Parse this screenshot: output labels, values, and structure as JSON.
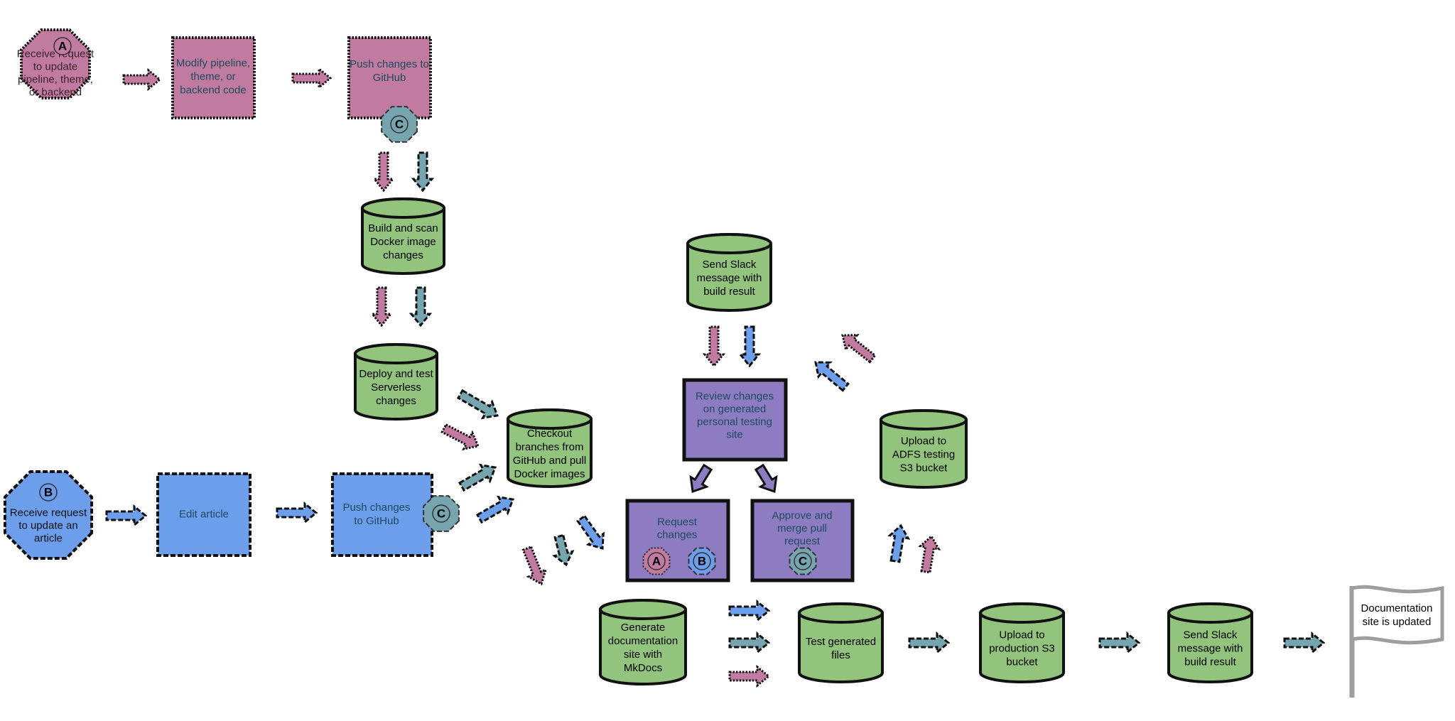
{
  "colors": {
    "pink": "#c27ba0",
    "teal": "#76a5af",
    "blue": "#6d9eeb",
    "purple": "#8e7cc3",
    "green": "#93c47d",
    "dark_text": "#1c4a5e",
    "flag": "#9e9e9e"
  },
  "nodes": {
    "start_a": {
      "badge": "A",
      "lines": [
        "Receive request",
        "to update",
        "pipeline, theme,",
        "or backend"
      ]
    },
    "modify": {
      "lines": [
        "Modify pipeline,",
        "theme, or",
        "backend code"
      ]
    },
    "push_a": {
      "lines": [
        "Push changes to",
        "GitHub"
      ],
      "badge": "C"
    },
    "build": {
      "lines": [
        "Build and scan",
        "Docker image",
        "changes"
      ]
    },
    "deploy": {
      "lines": [
        "Deploy and test",
        "Serverless",
        "changes"
      ]
    },
    "start_b": {
      "badge": "B",
      "lines": [
        "Receive request",
        "to update an",
        "article"
      ]
    },
    "edit": {
      "lines": [
        "Edit article"
      ]
    },
    "push_b": {
      "lines": [
        "Push changes",
        "to GitHub"
      ],
      "badge": "C"
    },
    "checkout": {
      "lines": [
        "Checkout",
        "branches from",
        "GitHub and pull",
        "Docker images"
      ]
    },
    "slack_top": {
      "lines": [
        "Send Slack",
        "message with",
        "build result"
      ]
    },
    "review": {
      "lines": [
        "Review changes",
        "on generated",
        "personal testing",
        "site"
      ]
    },
    "request_changes": {
      "lines": [
        "Request",
        "changes"
      ],
      "badges": [
        "A",
        "B"
      ]
    },
    "approve": {
      "lines": [
        "Approve and",
        "merge pull",
        "request"
      ],
      "badge": "C"
    },
    "adfs": {
      "lines": [
        "Upload to",
        "ADFS testing",
        "S3 bucket"
      ]
    },
    "generate": {
      "lines": [
        "Generate",
        "documentation",
        "site with",
        "MkDocs"
      ]
    },
    "test": {
      "lines": [
        "Test generated",
        "files"
      ]
    },
    "upload_prod": {
      "lines": [
        "Upload to",
        "production S3",
        "bucket"
      ]
    },
    "slack_bottom": {
      "lines": [
        "Send Slack",
        "message with",
        "build result"
      ]
    },
    "end": {
      "lines": [
        "Documentation",
        "site is updated"
      ]
    }
  }
}
